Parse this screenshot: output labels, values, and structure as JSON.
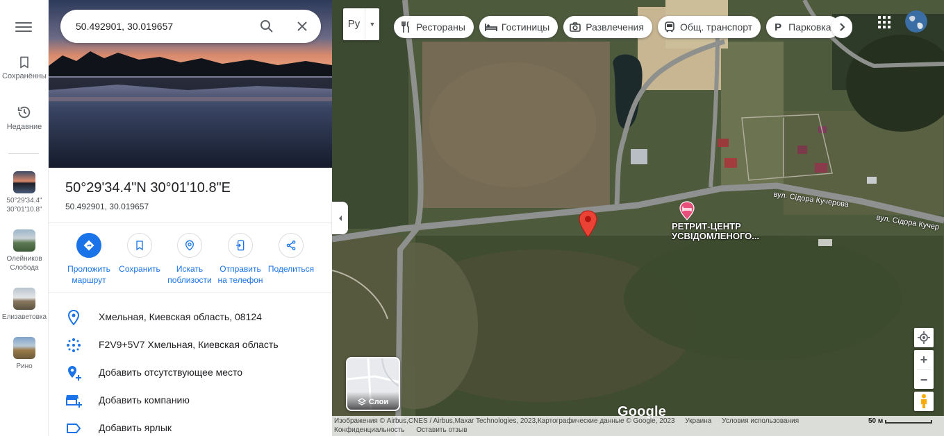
{
  "search": {
    "value": "50.492901, 30.019657"
  },
  "rail": {
    "saved_label": "Сохранённые",
    "recent_label": "Недавние",
    "recents": [
      {
        "label": "50°29'34.4\"\n30°01'10.8\""
      },
      {
        "label": "Олейников\nСлобода"
      },
      {
        "label": "Елизаветовка"
      },
      {
        "label": "Рино"
      }
    ]
  },
  "place": {
    "title": "50°29'34.4\"N 30°01'10.8\"E",
    "subtitle": "50.492901, 30.019657"
  },
  "actions": [
    {
      "label": "Проложить\nмаршрут",
      "icon": "directions-icon"
    },
    {
      "label": "Сохранить",
      "icon": "bookmark-icon"
    },
    {
      "label": "Искать\nпоблизости",
      "icon": "nearby-icon"
    },
    {
      "label": "Отправить\nна телефон",
      "icon": "send-to-phone-icon"
    },
    {
      "label": "Поделиться",
      "icon": "share-icon"
    }
  ],
  "info": [
    {
      "text": "Хмельная, Киевская область, 08124",
      "icon": "location-pin-icon"
    },
    {
      "text": "F2V9+5V7 Хмельная, Киевская область",
      "icon": "plus-code-icon"
    },
    {
      "text": "Добавить отсутствующее место",
      "icon": "add-place-icon"
    },
    {
      "text": "Добавить компанию",
      "icon": "add-business-icon"
    },
    {
      "text": "Добавить ярлык",
      "icon": "label-icon"
    }
  ],
  "map": {
    "language_code": "Ру",
    "chips": [
      {
        "label": "Рестораны",
        "icon": "restaurant-icon"
      },
      {
        "label": "Гостиницы",
        "icon": "hotel-icon"
      },
      {
        "label": "Развлечения",
        "icon": "camera-icon"
      },
      {
        "label": "Общ. транспорт",
        "icon": "transit-icon"
      },
      {
        "label": "Парковка",
        "icon": "parking-icon"
      }
    ],
    "poi_label_line1": "РЕТРИТ-ЦЕНТР",
    "poi_label_line2": "УСВІДОМЛЕНОГО...",
    "street_1": "вул. Сідора Кучерова",
    "street_2": "вул. Сідора Кучер",
    "layers_label": "Слои",
    "google_logo": "Google",
    "attribution": "Изображения © Airbus,CNES / Airbus,Maxar Technologies, 2023,Картографические данные © Google, 2023",
    "country": "Украина",
    "terms": "Условия использования",
    "privacy": "Конфиденциальность",
    "feedback": "Оставить отзыв",
    "scale_label": "50 м",
    "colors": {
      "accent": "#1a73e8",
      "pin": "#ea4335",
      "poi": "#e8507b"
    }
  }
}
